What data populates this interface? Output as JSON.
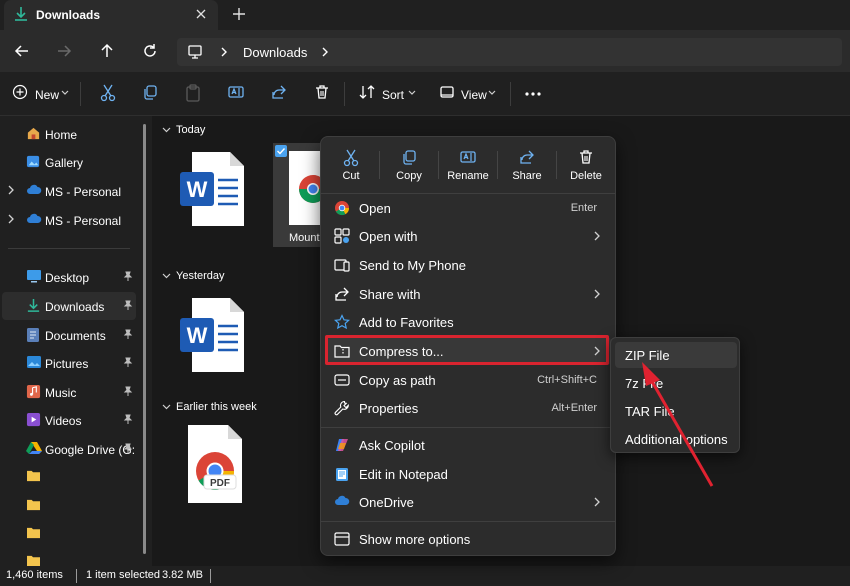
{
  "window": {
    "tab_title": "Downloads"
  },
  "address_bar": {
    "crumb": "Downloads"
  },
  "toolbar": {
    "new_label": "New",
    "sort_label": "Sort",
    "view_label": "View"
  },
  "sidebar": {
    "items": [
      {
        "label": "Home",
        "icon": "home-icon"
      },
      {
        "label": "Gallery",
        "icon": "gallery-icon"
      },
      {
        "label": "MS - Personal",
        "icon": "cloud-icon"
      },
      {
        "label": "MS - Personal",
        "icon": "cloud-icon"
      },
      {
        "label": "Desktop",
        "icon": "desktop-icon"
      },
      {
        "label": "Downloads",
        "icon": "download-icon"
      },
      {
        "label": "Documents",
        "icon": "documents-icon"
      },
      {
        "label": "Pictures",
        "icon": "pictures-icon"
      },
      {
        "label": "Music",
        "icon": "music-icon"
      },
      {
        "label": "Videos",
        "icon": "videos-icon"
      },
      {
        "label": "Google Drive (G:",
        "icon": "google-drive-icon"
      }
    ]
  },
  "content": {
    "groups": [
      {
        "label": "Today"
      },
      {
        "label": "Yesterday"
      },
      {
        "label": "Earlier this week"
      }
    ],
    "selected_file_label": "Mount"
  },
  "context_menu": {
    "quick_actions": [
      {
        "label": "Cut",
        "icon": "cut-icon"
      },
      {
        "label": "Copy",
        "icon": "copy-icon"
      },
      {
        "label": "Rename",
        "icon": "rename-icon"
      },
      {
        "label": "Share",
        "icon": "share-icon"
      },
      {
        "label": "Delete",
        "icon": "delete-icon"
      }
    ],
    "items": [
      {
        "label": "Open",
        "shortcut": "Enter",
        "icon": "chrome-icon"
      },
      {
        "label": "Open with",
        "icon": "open-with-icon"
      },
      {
        "label": "Send to My Phone",
        "icon": "phone-icon"
      },
      {
        "label": "Share with",
        "icon": "share-with-icon"
      },
      {
        "label": "Add to Favorites",
        "icon": "star-icon"
      },
      {
        "label": "Compress to...",
        "icon": "zip-folder-icon"
      },
      {
        "label": "Copy as path",
        "shortcut": "Ctrl+Shift+C",
        "icon": "copy-path-icon"
      },
      {
        "label": "Properties",
        "shortcut": "Alt+Enter",
        "icon": "wrench-icon"
      },
      {
        "label": "Ask Copilot",
        "icon": "copilot-icon"
      },
      {
        "label": "Edit in Notepad",
        "icon": "notepad-icon"
      },
      {
        "label": "OneDrive",
        "icon": "onedrive-icon"
      },
      {
        "label": "Show more options",
        "icon": "more-options-icon"
      }
    ]
  },
  "compress_submenu": {
    "items": [
      {
        "label": "ZIP File"
      },
      {
        "label": "7z File"
      },
      {
        "label": "TAR File"
      },
      {
        "label": "Additional options"
      }
    ]
  },
  "status_bar": {
    "item_count": "1,460 items",
    "selection": "1 item selected",
    "size": "3.82 MB"
  },
  "colors": {
    "highlight_box": "#d9242f",
    "accent": "#4aa3f0"
  }
}
